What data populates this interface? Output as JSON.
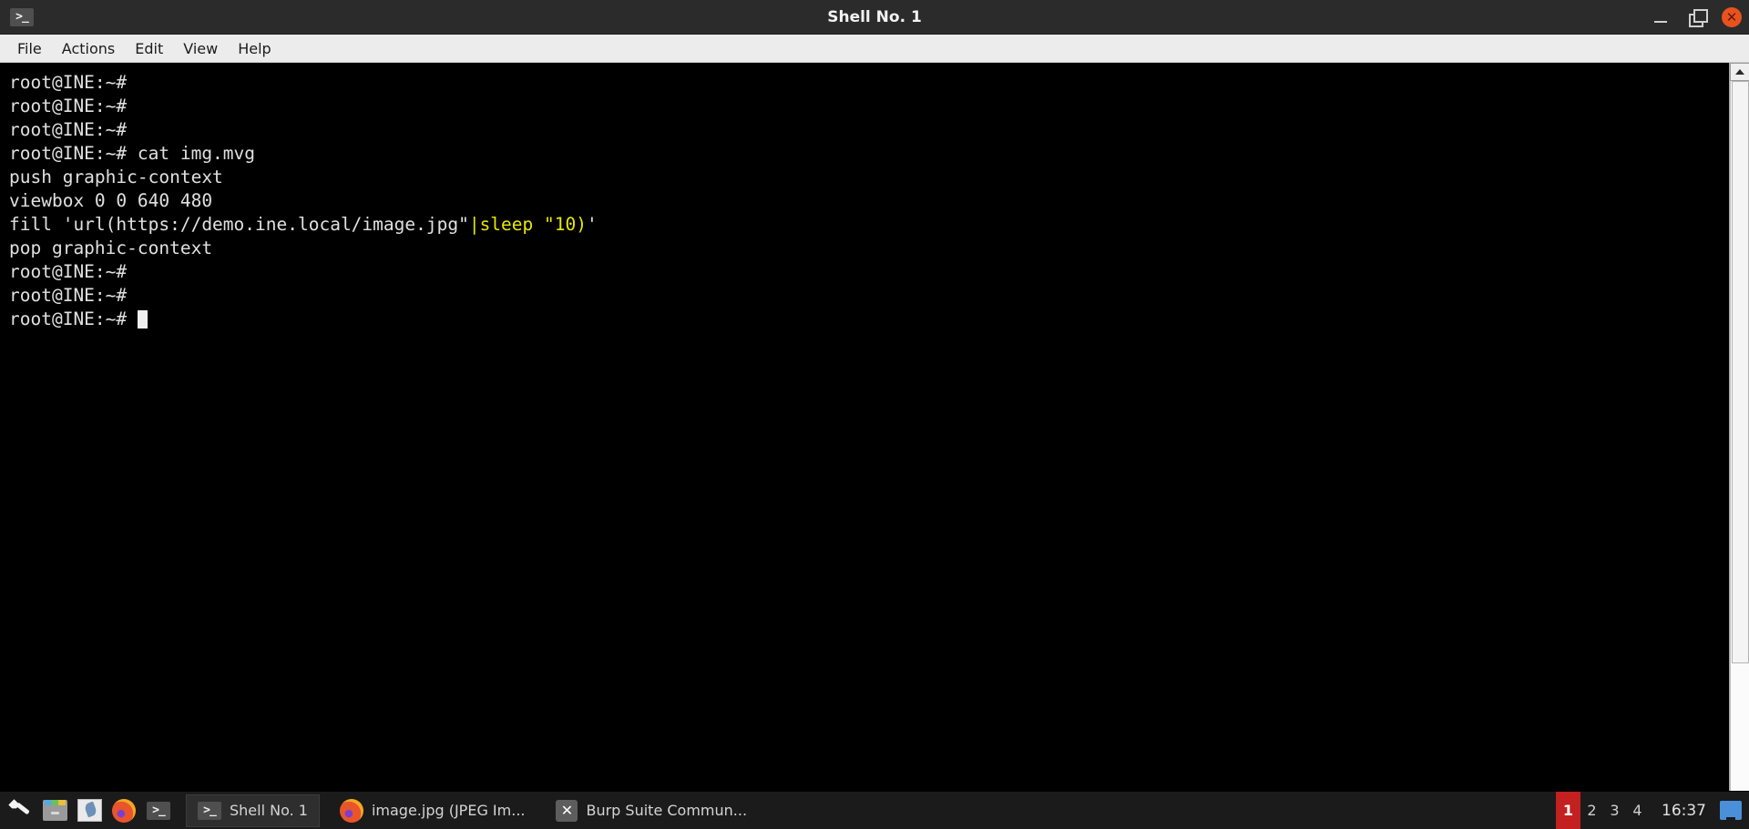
{
  "window": {
    "title": "Shell No. 1",
    "icon": "terminal-icon",
    "controls": {
      "minimize": "_",
      "maximize": "□",
      "close": "✕"
    }
  },
  "menubar": {
    "items": [
      {
        "label": "File"
      },
      {
        "label": "Actions"
      },
      {
        "label": "Edit"
      },
      {
        "label": "View"
      },
      {
        "label": "Help"
      }
    ]
  },
  "terminal": {
    "prompt": "root@INE:~#",
    "lines": [
      {
        "segments": [
          {
            "text": "root@INE:~#",
            "color": "white"
          }
        ]
      },
      {
        "segments": [
          {
            "text": "root@INE:~#",
            "color": "white"
          }
        ]
      },
      {
        "segments": [
          {
            "text": "root@INE:~#",
            "color": "white"
          }
        ]
      },
      {
        "segments": [
          {
            "text": "root@INE:~# cat img.mvg",
            "color": "white"
          }
        ]
      },
      {
        "segments": [
          {
            "text": "push graphic-context",
            "color": "white"
          }
        ]
      },
      {
        "segments": [
          {
            "text": "viewbox 0 0 640 480",
            "color": "white"
          }
        ]
      },
      {
        "segments": [
          {
            "text": "fill 'url(https://demo.ine.local/image.jpg\"",
            "color": "white"
          },
          {
            "text": "|sleep \"10)",
            "color": "yellow"
          },
          {
            "text": "'",
            "color": "white"
          }
        ]
      },
      {
        "segments": [
          {
            "text": "pop graphic-context",
            "color": "white"
          }
        ]
      },
      {
        "segments": [
          {
            "text": "root@INE:~#",
            "color": "white"
          }
        ]
      },
      {
        "segments": [
          {
            "text": "root@INE:~#",
            "color": "white"
          }
        ]
      },
      {
        "segments": [
          {
            "text": "root@INE:~# ",
            "color": "white"
          },
          {
            "cursor": true
          }
        ]
      }
    ],
    "colors": {
      "background": "#000000",
      "foreground": "#e0e0e0",
      "yellow": "#e8e800"
    }
  },
  "taskbar": {
    "launchers": [
      {
        "name": "applications-menu-icon",
        "label": "Applications"
      },
      {
        "name": "file-manager-icon",
        "label": "File Manager"
      },
      {
        "name": "text-editor-icon",
        "label": "Text Editor"
      },
      {
        "name": "firefox-icon",
        "label": "Firefox"
      },
      {
        "name": "terminal-icon",
        "label": "Terminal"
      }
    ],
    "windows": [
      {
        "label": "Shell No. 1",
        "icon": "terminal-icon",
        "active": true
      },
      {
        "label": "image.jpg (JPEG Im...",
        "icon": "firefox-icon",
        "active": false
      },
      {
        "label": "Burp Suite Commun...",
        "icon": "burp-suite-icon",
        "active": false
      }
    ],
    "workspaces": [
      {
        "label": "1",
        "active": true
      },
      {
        "label": "2",
        "active": false
      },
      {
        "label": "3",
        "active": false
      },
      {
        "label": "4",
        "active": false
      }
    ],
    "clock": "16:37",
    "show_desktop": "show-desktop-icon",
    "accent": "#c32020"
  }
}
